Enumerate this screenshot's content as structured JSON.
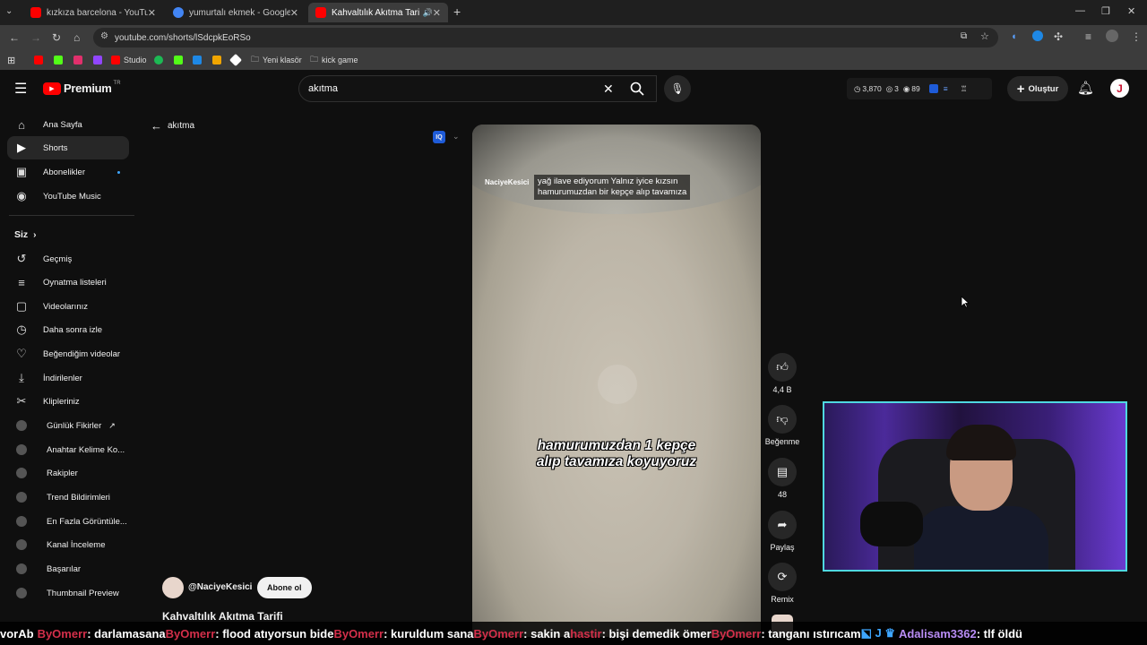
{
  "browser": {
    "tabs": [
      {
        "label": "kızkıza barcelona - YouTube",
        "color": "#ff0000"
      },
      {
        "label": "yumurtalı ekmek - Google'da A",
        "color": "#4285f4"
      },
      {
        "label": "Kahvaltılık Akıtma Tarifi - Yo",
        "color": "#ff0000"
      }
    ],
    "url": "youtube.com/shorts/lSdcpkEoRSo",
    "bookmarks": [
      {
        "label": "",
        "color": "#ff0000"
      },
      {
        "label": "",
        "color": "#53fc18"
      },
      {
        "label": "",
        "color": "#e1306c"
      },
      {
        "label": "",
        "color": "#9146ff"
      },
      {
        "label": "Studio",
        "color": "#ff0000"
      },
      {
        "label": "",
        "color": "#1db954"
      },
      {
        "label": "",
        "color": "#53fc18"
      },
      {
        "label": "",
        "color": "#1e88e5"
      },
      {
        "label": "",
        "color": "#f0a500"
      },
      {
        "label": "",
        "color": "#ffffff"
      },
      {
        "label": "Yeni klasör",
        "color": "#cccccc"
      },
      {
        "label": "kick game",
        "color": "#cccccc"
      }
    ]
  },
  "header": {
    "logo": "Premium",
    "logo_sup": "TR",
    "search_value": "akıtma",
    "stats": {
      "a": "3,870",
      "b": "3",
      "c": "89"
    },
    "create_label": "Oluştur",
    "avatar_letter": "J"
  },
  "sidebar": {
    "main": [
      {
        "label": "Ana Sayfa",
        "icon": "home-icon",
        "glyph": "⌂"
      },
      {
        "label": "Shorts",
        "icon": "shorts-icon",
        "glyph": "▶"
      },
      {
        "label": "Abonelikler",
        "icon": "subscriptions-icon",
        "glyph": "▣"
      },
      {
        "label": "YouTube Music",
        "icon": "music-icon",
        "glyph": "◉"
      }
    ],
    "you_label": "Siz",
    "you": [
      {
        "label": "Geçmiş",
        "icon": "history-icon",
        "glyph": "↺"
      },
      {
        "label": "Oynatma listeleri",
        "icon": "playlists-icon",
        "glyph": "≡"
      },
      {
        "label": "Videolarınız",
        "icon": "your-videos-icon",
        "glyph": "▢"
      },
      {
        "label": "Daha sonra izle",
        "icon": "watch-later-icon",
        "glyph": "◷"
      },
      {
        "label": "Beğendiğim videolar",
        "icon": "liked-icon",
        "glyph": "👍"
      },
      {
        "label": "İndirilenler",
        "icon": "downloads-icon",
        "glyph": "⤓"
      },
      {
        "label": "Klipleriniz",
        "icon": "clips-icon",
        "glyph": "✂"
      }
    ],
    "ext": [
      "Günlük Fikirler",
      "Anahtar Kelime Ko...",
      "Rakipler",
      "Trend Bildirimleri",
      "En Fazla Görüntüle...",
      "Kanal İnceleme",
      "Başarılar",
      "Thumbnail Preview"
    ]
  },
  "shorts": {
    "back_label": "akıtma",
    "iq_badge": "IQ",
    "caption_line1": "yağ ilave ediyorum Yalnız iyice kızsın",
    "caption_line2": "hamurumuzdan bir kepçe alıp tavamıza",
    "watermark": "NaciyeKesici",
    "subtitle_line1": "hamurumuzdan 1 kepçe",
    "subtitle_line2": "alıp tavamıza koyuyoruz",
    "channel": "@NaciyeKesici",
    "subscribe_label": "Abone ol",
    "title": "Kahvaltılık Akıtma Tarifi",
    "actions": {
      "likes": "4,4 B",
      "dislike": "Beğenme",
      "comments": "48",
      "share": "Paylaş",
      "remix": "Remix"
    }
  },
  "chat": [
    {
      "user": "",
      "msg": "vorAb"
    },
    {
      "user": "ByOmerr",
      "msg": ": darlamasana"
    },
    {
      "user": "ByOmerr",
      "msg": ": flood atıyorsun bide"
    },
    {
      "user": "ByOmerr",
      "msg": ": kuruldum sana"
    },
    {
      "user": "ByOmerr",
      "msg": ": sakin a"
    },
    {
      "user": "hastir",
      "msg": ": bişi demedik ömer"
    },
    {
      "user": "ByOmerr",
      "msg": ": tanganı ıstırıcam"
    },
    {
      "user": "Adalisam3362",
      "msg": ": tlf öldü"
    }
  ]
}
